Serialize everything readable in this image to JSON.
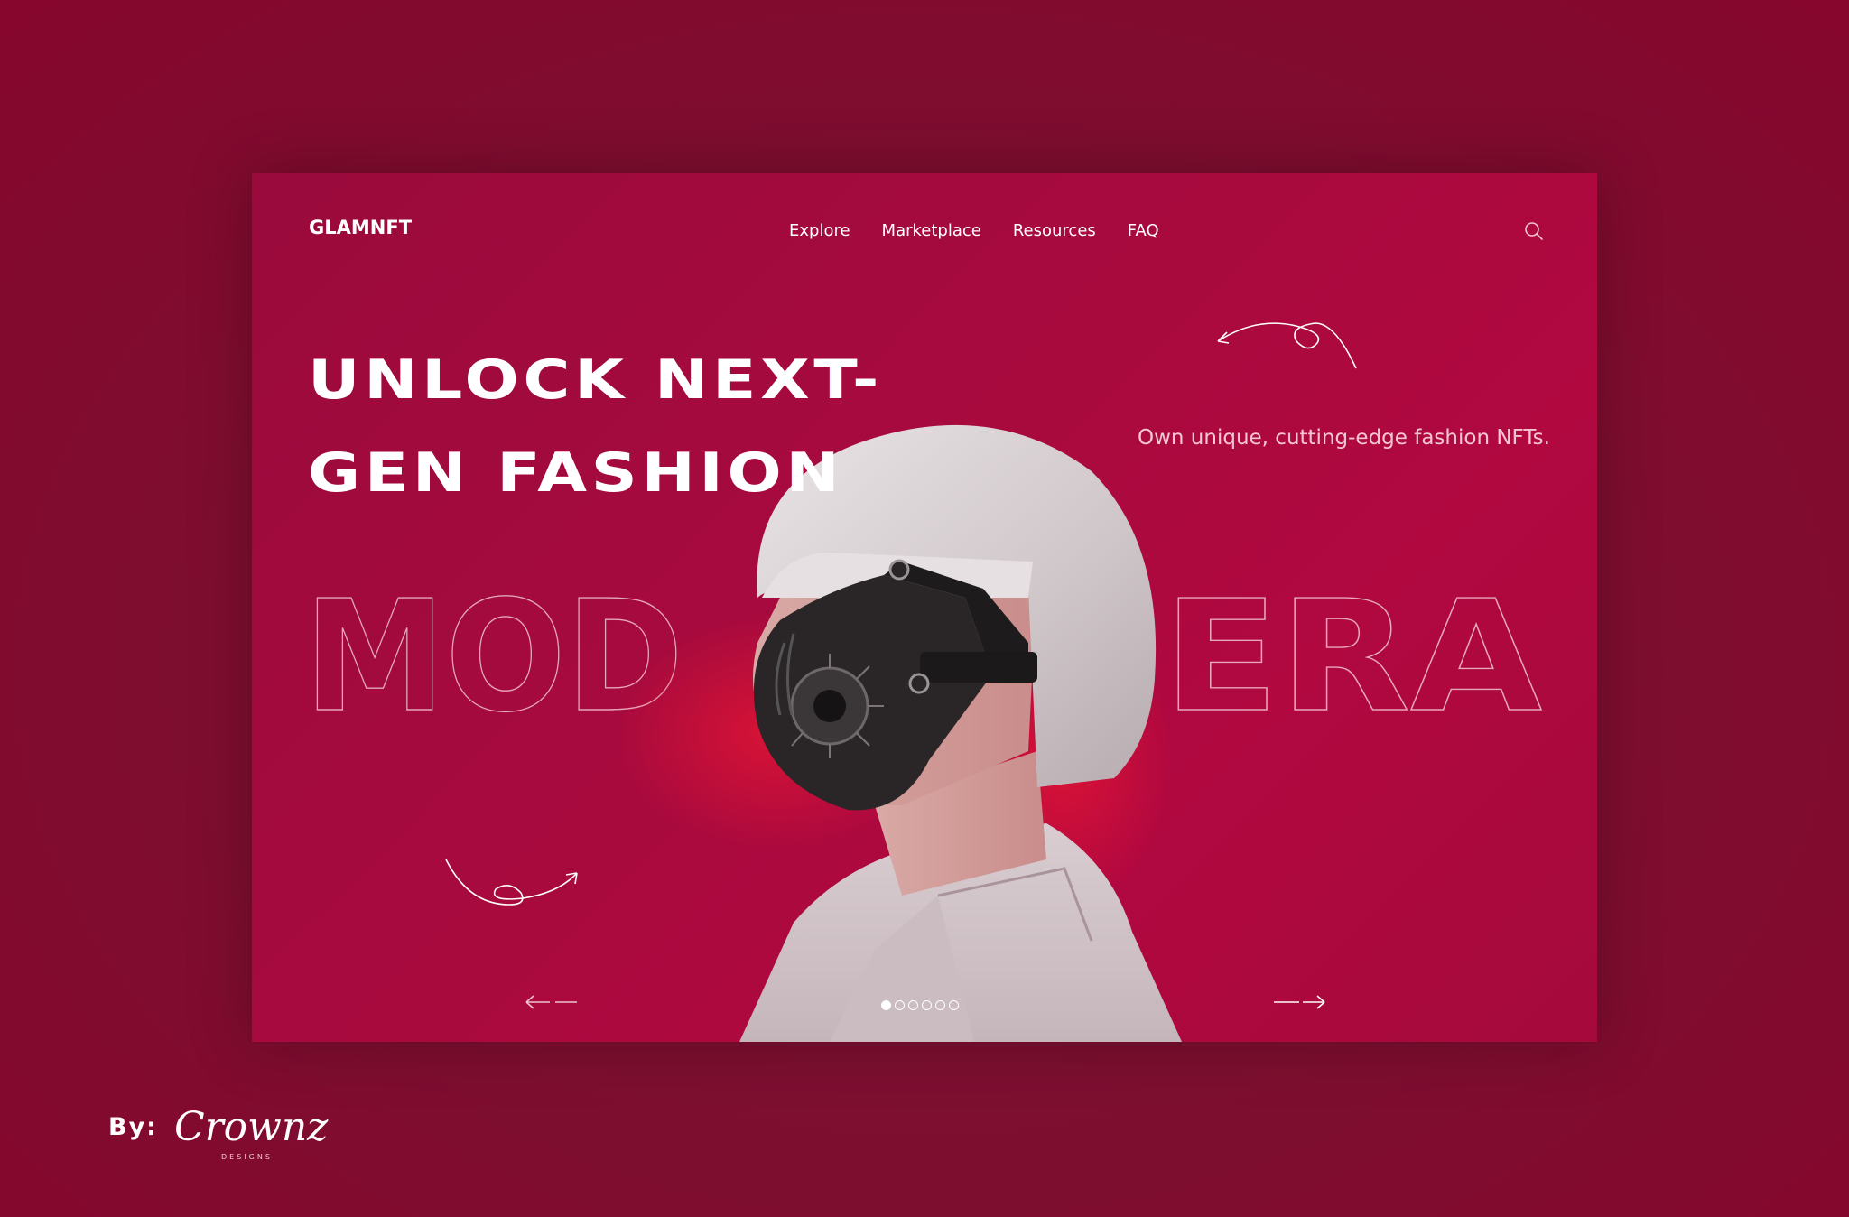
{
  "brand": {
    "logo_text": "GLAMNFT"
  },
  "nav": {
    "items": [
      "Explore",
      "Marketplace",
      "Resources",
      "FAQ"
    ]
  },
  "hero": {
    "headline_line1": "UNLOCK NEXT-",
    "headline_line2": "GEN FASHION",
    "tagline": "Own unique, cutting-edge fashion NFTs.",
    "outline_left": "MOD",
    "outline_right": "ERA"
  },
  "carousel": {
    "dot_count": 6,
    "active_index": 0
  },
  "credit": {
    "by_label": "By:",
    "signature": "Crownz",
    "signature_sub": "DESIGNS"
  },
  "colors": {
    "page_bg": "#7e0e30",
    "frame_bg": "#a50a3c",
    "text": "#ffffff",
    "tagline": "#f3c6d2"
  }
}
